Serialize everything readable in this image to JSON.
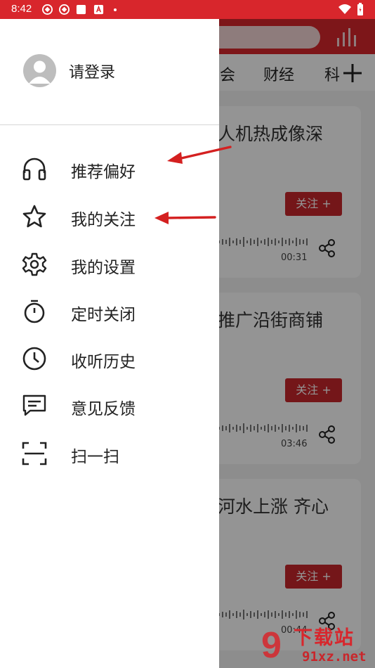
{
  "status_bar": {
    "time": "8:42"
  },
  "background_app": {
    "tabs": [
      "会",
      "财经",
      "科"
    ],
    "cards": [
      {
        "title": "人机热成像深",
        "follow_label": "关注 +",
        "duration": "00:31"
      },
      {
        "title": "推广沿街商铺",
        "follow_label": "关注 +",
        "duration": "03:46"
      },
      {
        "title": "河水上涨 齐心",
        "follow_label": "关注 +",
        "duration": "00:44"
      }
    ]
  },
  "drawer": {
    "login_label": "请登录",
    "menu": [
      {
        "label": "推荐偏好",
        "icon": "headphones-icon"
      },
      {
        "label": "我的关注",
        "icon": "star-icon"
      },
      {
        "label": "我的设置",
        "icon": "gear-icon"
      },
      {
        "label": "定时关闭",
        "icon": "stopwatch-icon"
      },
      {
        "label": "收听历史",
        "icon": "clock-icon"
      },
      {
        "label": "意见反馈",
        "icon": "chat-icon"
      },
      {
        "label": "扫一扫",
        "icon": "scan-icon"
      }
    ]
  },
  "watermark": {
    "top_text": "下载站",
    "bottom_text": "91xz.net",
    "logo_text": "9"
  },
  "colors": {
    "brand_red": "#d8262c",
    "annotation_arrow": "#d42020"
  }
}
